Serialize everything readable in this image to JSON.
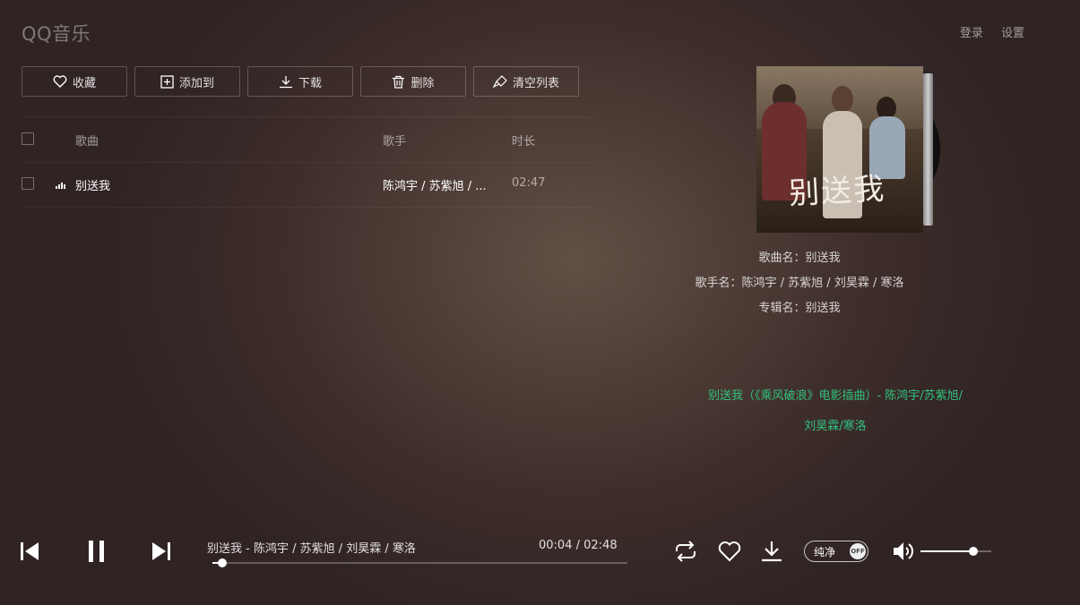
{
  "app": {
    "logo": "QQ音乐"
  },
  "top_links": {
    "login": "登录",
    "settings": "设置"
  },
  "toolbar": {
    "favorite": "收藏",
    "add_to": "添加到",
    "download": "下载",
    "delete": "删除",
    "clear_list": "清空列表"
  },
  "list": {
    "headers": {
      "song": "歌曲",
      "singer": "歌手",
      "duration": "时长"
    },
    "rows": [
      {
        "song": "别送我",
        "singer": "陈鸿宇 / 苏紫旭 / ...",
        "duration": "02:47"
      }
    ]
  },
  "album": {
    "cover_title": "别送我",
    "song_name": "歌曲名：别送我",
    "singer_name": "歌手名：陈鸿宇 / 苏紫旭 / 刘昊霖 / 寒洛",
    "album_name": "专辑名：别送我"
  },
  "lyrics": {
    "line1": "别送我（《乘风破浪》电影插曲）- 陈鸿宇/苏紫旭/",
    "line2": "刘昊霖/寒洛",
    "color": "#31c27c"
  },
  "player": {
    "now_playing": "别送我 - 陈鸿宇 / 苏紫旭 / 刘昊霖 / 寒洛",
    "current_time": "00:04",
    "time_sep": "/",
    "total_time": "02:48",
    "progress_fraction": 0.024,
    "pure_mode_label": "纯净",
    "pure_mode_state": "OFF",
    "volume_fraction": 0.75
  },
  "icons": {
    "prev": "skip-previous-icon",
    "pause": "pause-icon",
    "next": "skip-next-icon",
    "loop": "loop-icon",
    "like": "heart-icon",
    "download": "download-icon",
    "volume": "volume-icon"
  }
}
